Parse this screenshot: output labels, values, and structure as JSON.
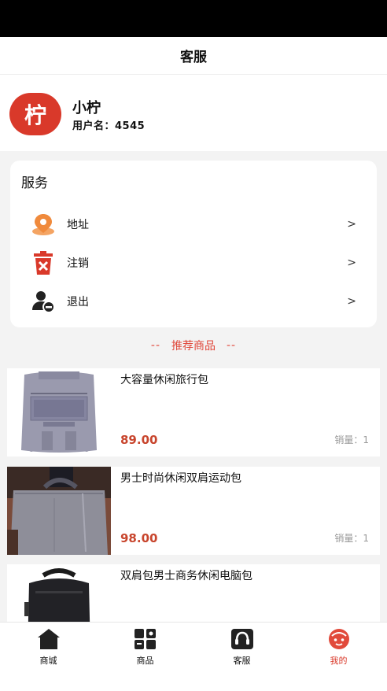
{
  "nav": {
    "title": "客服"
  },
  "profile": {
    "avatar_glyph": "柠",
    "name": "小柠",
    "username_label": "用户名：",
    "username_value": "4545"
  },
  "services": {
    "title": "服务",
    "items": [
      {
        "label": "地址",
        "icon": "location-pin-icon",
        "arrow": ">"
      },
      {
        "label": "注销",
        "icon": "trash-cancel-icon",
        "arrow": ">"
      },
      {
        "label": "退出",
        "icon": "user-logout-icon",
        "arrow": ">"
      }
    ]
  },
  "recommend": {
    "dash_left": "--",
    "title": "推荐商品",
    "dash_right": "--"
  },
  "products": [
    {
      "name": "大容量休闲旅行包",
      "price": "89.00",
      "sales_label": "销量：",
      "sales_value": "1",
      "image": "gray-travel-backpack"
    },
    {
      "name": "男士时尚休闲双肩运动包",
      "price": "98.00",
      "sales_label": "销量：",
      "sales_value": "1",
      "image": "gray-laptop-bag-held"
    },
    {
      "name": "双肩包男士商务休闲电脑包",
      "price": "",
      "sales_label": "",
      "sales_value": "",
      "image": "black-business-backpack"
    }
  ],
  "tabs": [
    {
      "label": "商城",
      "icon": "house-icon",
      "active": false
    },
    {
      "label": "商品",
      "icon": "grid-icon",
      "active": false
    },
    {
      "label": "客服",
      "icon": "headset-icon",
      "active": false
    },
    {
      "label": "我的",
      "icon": "user-face-icon",
      "active": true
    }
  ],
  "colors": {
    "accent": "#d9392a",
    "price": "#c8452d",
    "recommend": "#e0473a"
  }
}
